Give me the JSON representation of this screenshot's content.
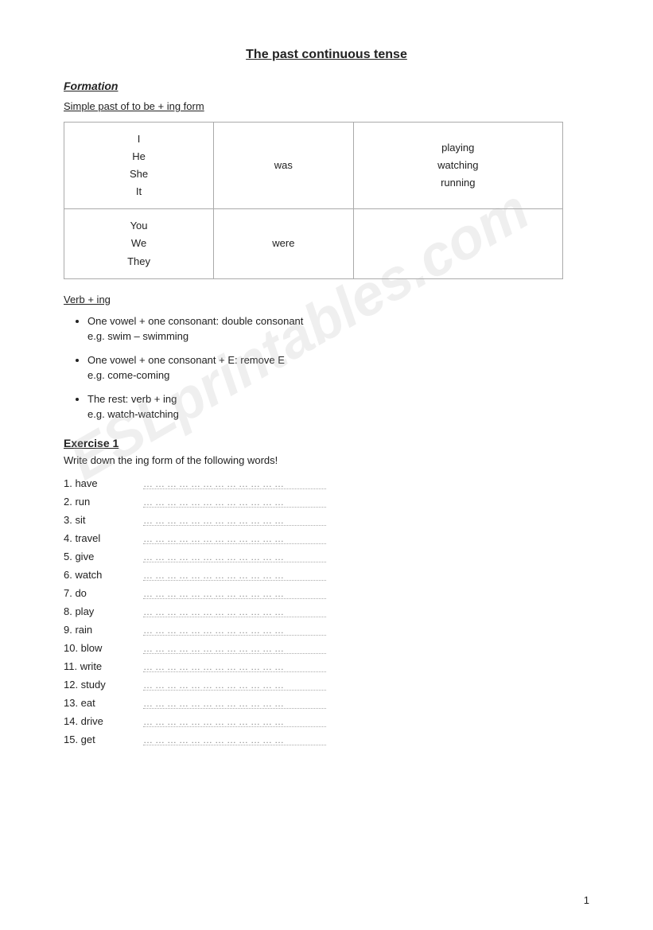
{
  "page": {
    "title": "The past continuous tense",
    "page_number": "1",
    "watermark": "ESLprintables.com"
  },
  "formation": {
    "label": "Formation",
    "subtitle": "Simple past of to be + ing form"
  },
  "table": {
    "rows": [
      {
        "pronouns": [
          "I",
          "He",
          "She",
          "It"
        ],
        "verb": "was",
        "examples": [
          "playing",
          "watching",
          "running"
        ]
      },
      {
        "pronouns": [
          "You",
          "We",
          "They"
        ],
        "verb": "were",
        "examples": []
      }
    ]
  },
  "verb_ing": {
    "title": "Verb + ing",
    "bullets": [
      {
        "rule": "One vowel + one consonant: double consonant",
        "example": "e.g. swim – swimming"
      },
      {
        "rule": "One vowel + one consonant + E: remove E",
        "example": "e.g. come-coming"
      },
      {
        "rule": "The rest: verb + ing",
        "example": "e.g. watch-watching"
      }
    ]
  },
  "exercise": {
    "title": "Exercise 1",
    "instruction": "Write down the ing form of the following words!",
    "words": [
      {
        "num": "1.",
        "word": "have"
      },
      {
        "num": "2.",
        "word": "run"
      },
      {
        "num": "3.",
        "word": "sit"
      },
      {
        "num": "4.",
        "word": "travel"
      },
      {
        "num": "5.",
        "word": "give"
      },
      {
        "num": "6.",
        "word": "watch"
      },
      {
        "num": "7.",
        "word": "do"
      },
      {
        "num": "8.",
        "word": "play"
      },
      {
        "num": "9.",
        "word": "rain"
      },
      {
        "num": "10.",
        "word": "blow"
      },
      {
        "num": "11.",
        "word": "write"
      },
      {
        "num": "12.",
        "word": "study"
      },
      {
        "num": "13.",
        "word": "eat"
      },
      {
        "num": "14.",
        "word": "drive"
      },
      {
        "num": "15.",
        "word": "get"
      }
    ],
    "dotted_placeholder": "………………………………"
  }
}
